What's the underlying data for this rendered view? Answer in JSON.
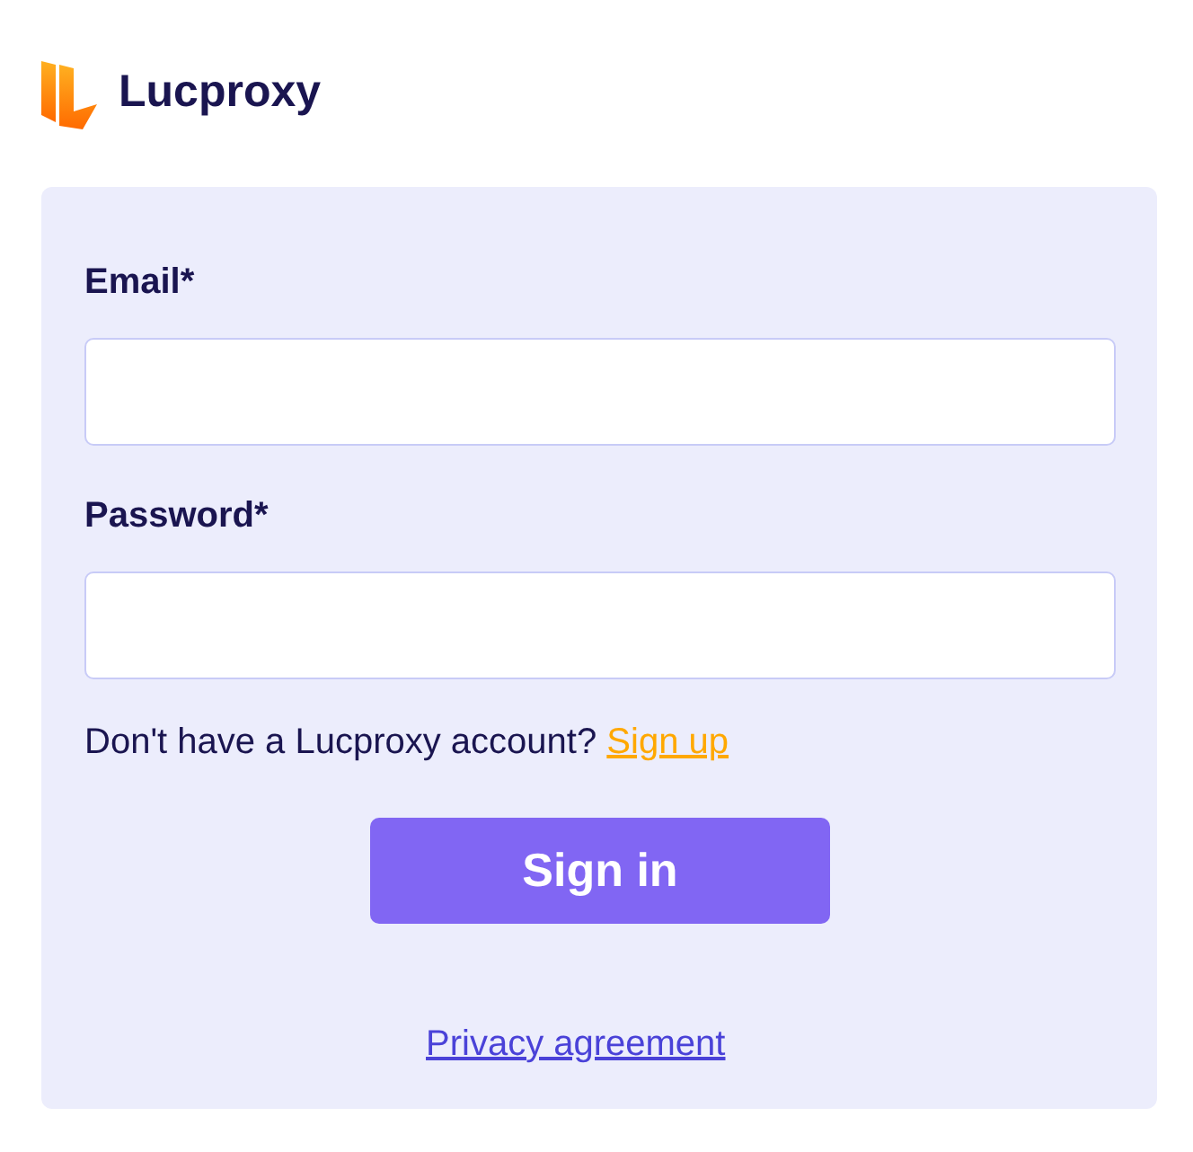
{
  "brand": {
    "name": "Lucproxy"
  },
  "fields": [
    {
      "label": "Email*"
    },
    {
      "label": "Password*"
    }
  ],
  "signup_prompt": {
    "text": "Don't have a Lucproxy account?",
    "link": "Sign up"
  },
  "submit": "Sign in",
  "footer_link": "Privacy agreement"
}
